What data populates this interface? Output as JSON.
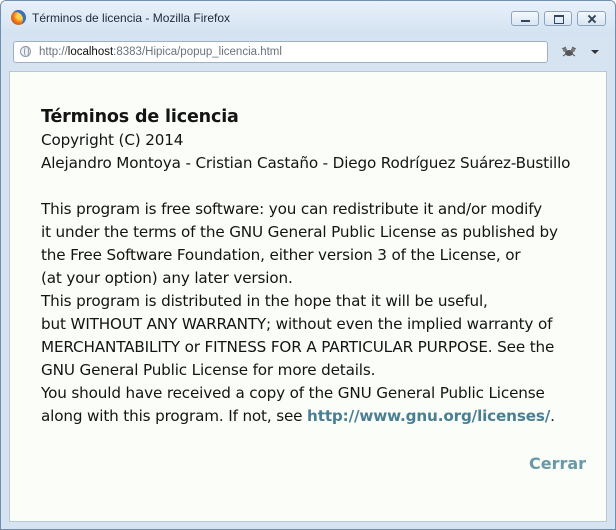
{
  "window": {
    "title": "Términos de licencia - Mozilla Firefox"
  },
  "urlbar": {
    "scheme": "http://",
    "host": "localhost",
    "rest": ":8383/Hipica/popup_licencia.html"
  },
  "license": {
    "heading": "Términos de licencia",
    "copyright": "Copyright (C) 2014",
    "authors": "Alejandro Montoya - Cristian Castaño - Diego Rodríguez Suárez-Bustillo",
    "paragraph_lines": [
      "This program is free software: you can redistribute it and/or modify",
      "it under the terms of the GNU General Public License as published by",
      "the Free Software Foundation, either version 3 of the License, or",
      "(at your option) any later version.",
      "This program is distributed in the hope that it will be useful,",
      "but WITHOUT ANY WARRANTY; without even the implied warranty of",
      "MERCHANTABILITY or FITNESS FOR A PARTICULAR PURPOSE. See the",
      "GNU General Public License for more details.",
      "You should have received a copy of the GNU General Public License"
    ],
    "last_line_prefix": "along with this program. If not, see ",
    "link_text": "http://www.gnu.org/licenses/",
    "last_line_suffix": "."
  },
  "actions": {
    "close_label": "Cerrar"
  },
  "colors": {
    "link": "#4a7f93",
    "close": "#6a98a6",
    "content_bg": "#fbfdf9"
  }
}
